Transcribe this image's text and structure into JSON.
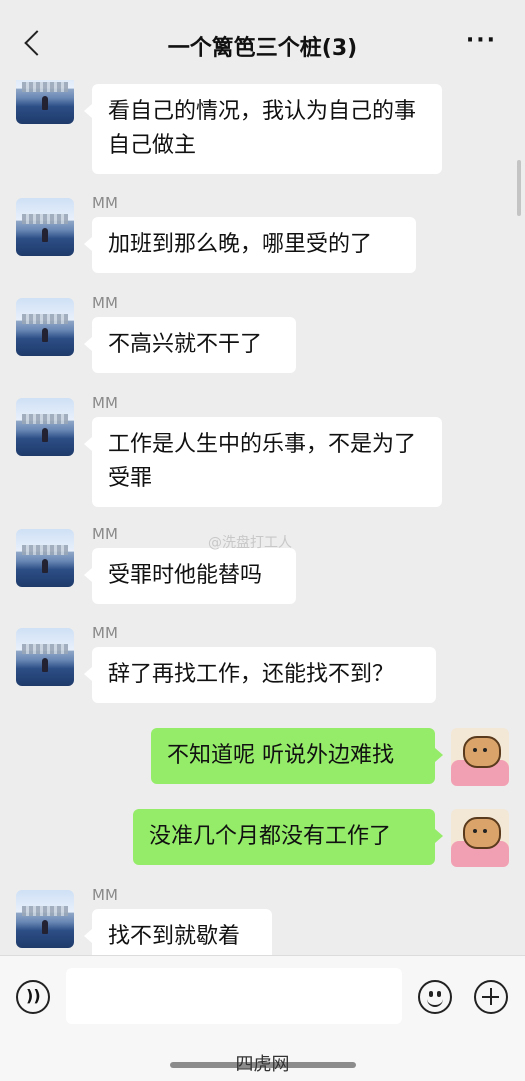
{
  "header": {
    "title": "一个篱笆三个桩(3)",
    "more_label": "···"
  },
  "watermark": "@洗盘打工人",
  "messages": [
    {
      "side": "left",
      "sender": "",
      "text": "看自己的情况，我认为自己的事自己做主",
      "avatar": "city-avatar"
    },
    {
      "side": "left",
      "sender": "MM",
      "text": "加班到那么晚，哪里受的了",
      "avatar": "city-avatar"
    },
    {
      "side": "left",
      "sender": "MM",
      "text": "不高兴就不干了",
      "avatar": "city-avatar"
    },
    {
      "side": "left",
      "sender": "MM",
      "text": "工作是人生中的乐事，不是为了受罪",
      "avatar": "city-avatar"
    },
    {
      "side": "left",
      "sender": "MM",
      "text": "受罪时他能替吗",
      "avatar": "city-avatar"
    },
    {
      "side": "left",
      "sender": "MM",
      "text": "辞了再找工作，还能找不到？",
      "avatar": "city-avatar"
    },
    {
      "side": "right",
      "sender": "",
      "text": "不知道呢 听说外边难找",
      "avatar": "bear-avatar"
    },
    {
      "side": "right",
      "sender": "",
      "text": "没准几个月都没有工作了",
      "avatar": "bear-avatar"
    },
    {
      "side": "left",
      "sender": "MM",
      "text": "找不到就歇着",
      "avatar": "city-avatar"
    }
  ],
  "input_bar": {
    "voice_icon": "voice-icon",
    "emoji_icon": "emoji-icon",
    "plus_icon": "plus-icon"
  },
  "footer_mark": "四虎网",
  "colors": {
    "background": "#ededed",
    "incoming_bubble": "#ffffff",
    "outgoing_bubble": "#95ec69"
  }
}
